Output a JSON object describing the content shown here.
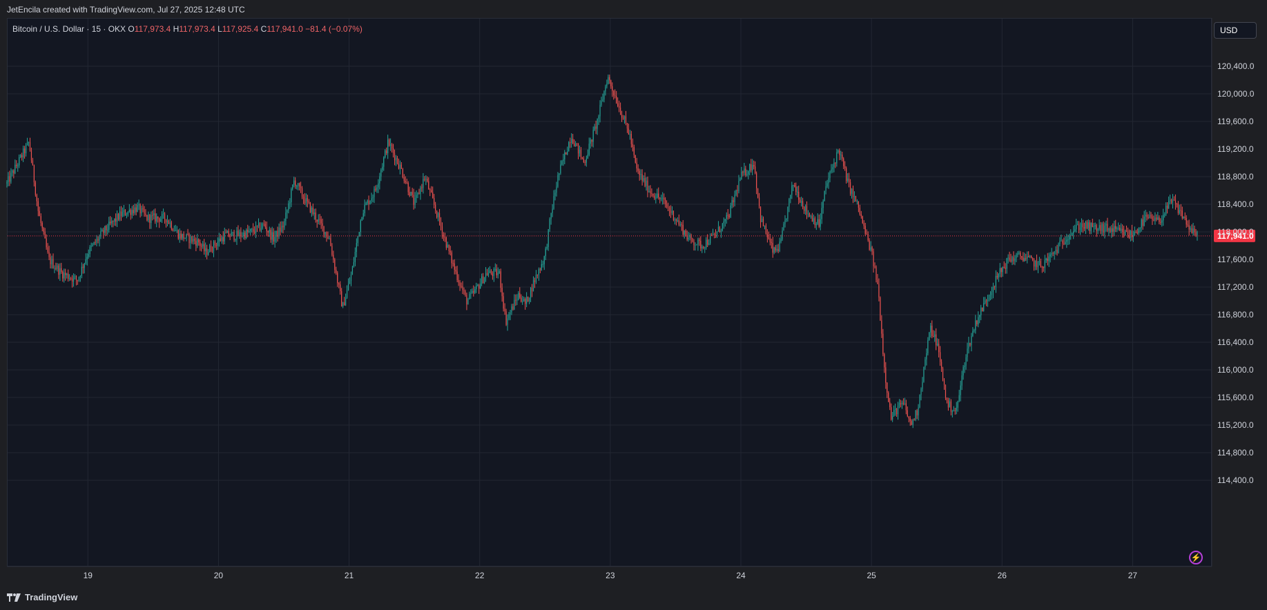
{
  "header": {
    "attribution": "JetEncila created with TradingView.com, Jul 27, 2025 12:48 UTC"
  },
  "legend": {
    "symbol": "Bitcoin / U.S. Dollar · 15 · OKX",
    "open_label": "O",
    "open": "117,973.4",
    "high_label": "H",
    "high": "117,973.4",
    "low_label": "L",
    "low": "117,925.4",
    "close_label": "C",
    "close": "117,941.0",
    "change": "−81.4 (−0.07%)"
  },
  "scale": {
    "currency": "USD"
  },
  "footer": {
    "brand": "TradingView"
  },
  "colors": {
    "up": "#26a69a",
    "down": "#ef5350",
    "background": "#131722",
    "grid": "#232733",
    "price_line": "#f23645"
  },
  "icons": {
    "lightning": "lightning-icon",
    "logo": "tradingview-logo-icon"
  },
  "chart_data": {
    "type": "candlestick",
    "title": "Bitcoin / U.S. Dollar · 15 · OKX",
    "ylim": [
      114000,
      120800
    ],
    "y_ticks": [
      "114,400.0",
      "114,800.0",
      "115,200.0",
      "115,600.0",
      "116,000.0",
      "116,400.0",
      "116,800.0",
      "117,200.0",
      "117,600.0",
      "118,000.0",
      "118,400.0",
      "118,800.0",
      "119,200.0",
      "119,600.0",
      "120,000.0",
      "120,400.0"
    ],
    "y_tick_values": [
      114400,
      114800,
      115200,
      115600,
      116000,
      116400,
      116800,
      117200,
      117600,
      118000,
      118400,
      118800,
      119200,
      119600,
      120000,
      120400
    ],
    "x_ticks": [
      "19",
      "20",
      "21",
      "22",
      "23",
      "24",
      "25",
      "26",
      "27"
    ],
    "x_tick_days": [
      19,
      20,
      21,
      22,
      23,
      24,
      25,
      26,
      27
    ],
    "x_range_days": [
      18.38,
      27.5
    ],
    "last_price": 117941.0,
    "last_price_label": "117,941.0",
    "grid": true,
    "path_day": [
      18.38,
      18.55,
      18.62,
      18.7,
      18.8,
      18.92,
      19.0,
      19.12,
      19.25,
      19.38,
      19.45,
      19.6,
      19.7,
      19.85,
      19.9,
      20.05,
      20.15,
      20.25,
      20.35,
      20.42,
      20.5,
      20.58,
      20.65,
      20.75,
      20.85,
      20.9,
      20.95,
      21.02,
      21.1,
      21.2,
      21.3,
      21.4,
      21.5,
      21.58,
      21.7,
      21.8,
      21.9,
      21.95,
      22.05,
      22.15,
      22.2,
      22.3,
      22.35,
      22.42,
      22.5,
      22.55,
      22.6,
      22.7,
      22.8,
      22.9,
      22.98,
      23.05,
      23.15,
      23.2,
      23.3,
      23.4,
      23.5,
      23.6,
      23.7,
      23.8,
      23.9,
      24.0,
      24.1,
      24.15,
      24.25,
      24.3,
      24.4,
      24.5,
      24.6,
      24.65,
      24.75,
      24.82,
      24.9,
      24.95,
      25.0,
      25.05,
      25.1,
      25.15,
      25.2,
      25.25,
      25.3,
      25.35,
      25.45,
      25.5,
      25.58,
      25.65,
      25.72,
      25.8,
      25.9,
      25.98,
      26.05,
      26.15,
      26.25,
      26.3,
      26.4,
      26.5,
      26.6,
      26.7,
      26.8,
      26.9,
      27.0,
      27.1,
      27.2,
      27.3,
      27.38,
      27.45,
      27.5
    ],
    "path_price": [
      118700,
      119300,
      118300,
      117600,
      117400,
      117300,
      117700,
      118000,
      118250,
      118350,
      118200,
      118200,
      117950,
      117850,
      117700,
      117950,
      117950,
      118000,
      118100,
      117900,
      118100,
      118750,
      118500,
      118200,
      117900,
      117400,
      116900,
      117400,
      118300,
      118600,
      119300,
      118900,
      118400,
      118800,
      118100,
      117500,
      117000,
      117100,
      117400,
      117400,
      116700,
      117100,
      116950,
      117300,
      117650,
      118300,
      118800,
      119400,
      119000,
      119600,
      120250,
      119900,
      119400,
      118900,
      118600,
      118450,
      118200,
      117900,
      117800,
      117950,
      118200,
      118800,
      119000,
      118200,
      117700,
      117800,
      118700,
      118300,
      118100,
      118650,
      119200,
      118700,
      118350,
      118000,
      117700,
      117200,
      116000,
      115300,
      115450,
      115500,
      115200,
      115400,
      116600,
      116400,
      115500,
      115400,
      116200,
      116700,
      117100,
      117400,
      117600,
      117650,
      117550,
      117500,
      117700,
      117950,
      118100,
      118050,
      118050,
      118000,
      117950,
      118200,
      118150,
      118450,
      118250,
      118000,
      117941
    ]
  }
}
